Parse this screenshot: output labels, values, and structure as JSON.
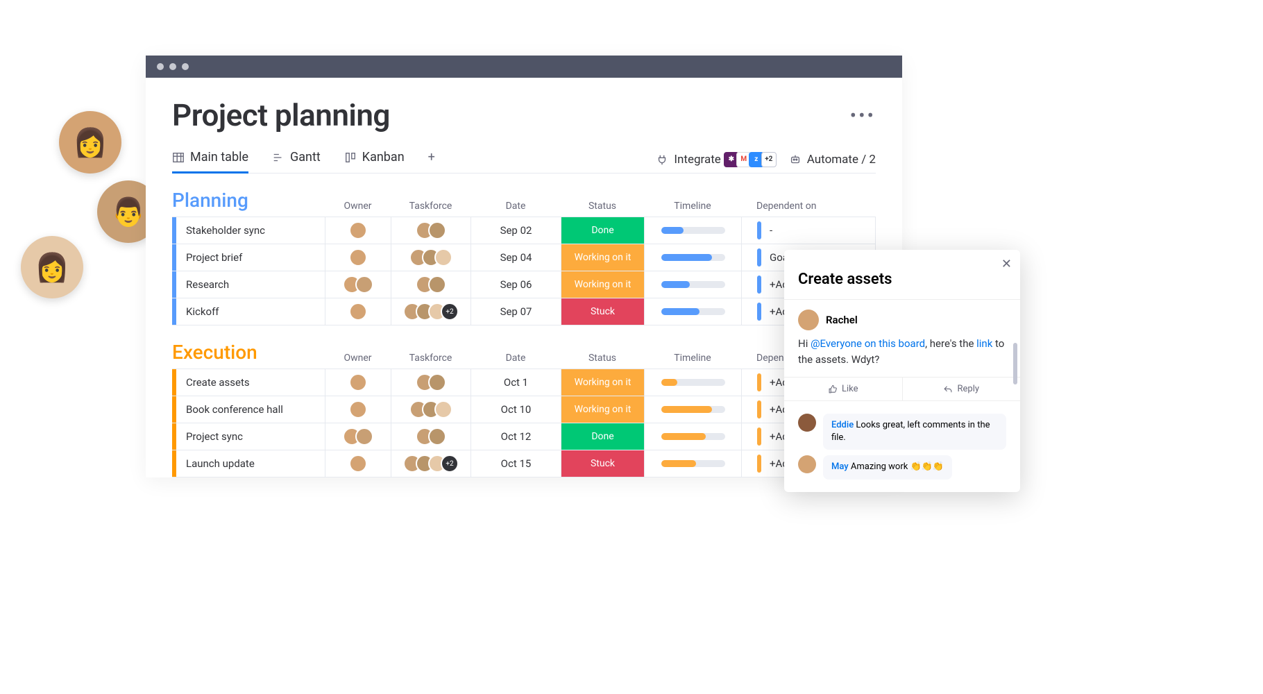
{
  "board_title": "Project planning",
  "tabs": {
    "main": "Main table",
    "gantt": "Gantt",
    "kanban": "Kanban"
  },
  "toolbar": {
    "integrate": "Integrate",
    "automate": "Automate / 2",
    "integration_more": "+2"
  },
  "columns": {
    "owner": "Owner",
    "taskforce": "Taskforce",
    "date": "Date",
    "status": "Status",
    "timeline": "Timeline",
    "dependent": "Dependent on"
  },
  "groups": [
    {
      "name": "Planning",
      "color": "#579bfc",
      "rows": [
        {
          "name": "Stakeholder sync",
          "date": "Sep 02",
          "status": "Done",
          "status_key": "done",
          "timeline_pct": 35,
          "owner_count": 1,
          "task_count": 2,
          "task_plus": "",
          "dep": "-"
        },
        {
          "name": "Project brief",
          "date": "Sep 04",
          "status": "Working on it",
          "status_key": "work",
          "timeline_pct": 80,
          "owner_count": 1,
          "task_count": 3,
          "task_plus": "",
          "dep": "Goal"
        },
        {
          "name": "Research",
          "date": "Sep 06",
          "status": "Working on it",
          "status_key": "work",
          "timeline_pct": 45,
          "owner_count": 2,
          "task_count": 2,
          "task_plus": "",
          "dep": "+Add"
        },
        {
          "name": "Kickoff",
          "date": "Sep 07",
          "status": "Stuck",
          "status_key": "stuck",
          "timeline_pct": 60,
          "owner_count": 1,
          "task_count": 3,
          "task_plus": "+2",
          "dep": "+Add"
        }
      ]
    },
    {
      "name": "Execution",
      "color": "#ff9900",
      "rows": [
        {
          "name": "Create assets",
          "date": "Oct 1",
          "status": "Working on it",
          "status_key": "work",
          "timeline_pct": 25,
          "owner_count": 1,
          "task_count": 2,
          "task_plus": "",
          "dep": "+Add"
        },
        {
          "name": "Book conference hall",
          "date": "Oct 10",
          "status": "Working on it",
          "status_key": "work",
          "timeline_pct": 80,
          "owner_count": 1,
          "task_count": 3,
          "task_plus": "",
          "dep": "+Add"
        },
        {
          "name": "Project sync",
          "date": "Oct 12",
          "status": "Done",
          "status_key": "done",
          "timeline_pct": 70,
          "owner_count": 2,
          "task_count": 2,
          "task_plus": "",
          "dep": "+Add"
        },
        {
          "name": "Launch update",
          "date": "Oct 15",
          "status": "Stuck",
          "status_key": "stuck",
          "timeline_pct": 55,
          "owner_count": 1,
          "task_count": 3,
          "task_plus": "+2",
          "dep": "+Add"
        }
      ]
    }
  ],
  "panel": {
    "title": "Create assets",
    "author": "Rachel",
    "body_pre": "Hi ",
    "body_mention": "@Everyone on this board",
    "body_mid": ", here's the ",
    "body_link": "link",
    "body_post": " to the assets. Wdyt?",
    "like": "Like",
    "reply": "Reply",
    "replies": [
      {
        "name": "Eddie",
        "text": " Looks great, left comments in the file.",
        "color": "#8b5a3c"
      },
      {
        "name": "May",
        "text": " Amazing work 👏👏👏",
        "color": "#d4a373"
      }
    ]
  },
  "avatar_colors": [
    "#d4a373",
    "#c89f74",
    "#b8956a",
    "#e6c9a8",
    "#a67c52"
  ]
}
